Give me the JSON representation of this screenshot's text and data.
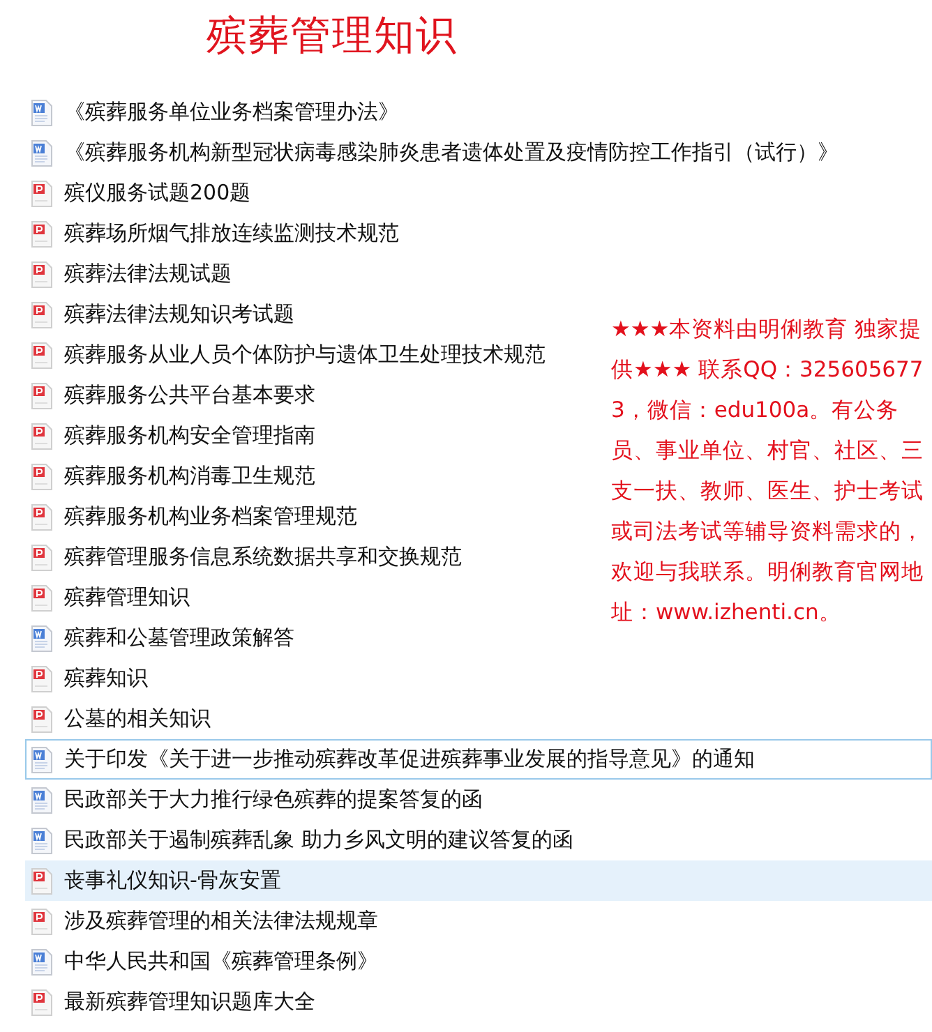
{
  "title": "殡葬管理知识",
  "files": [
    {
      "name": "《殡葬服务单位业务档案管理办法》",
      "kind": "word",
      "selected": false,
      "focused": false
    },
    {
      "name": "《殡葬服务机构新型冠状病毒感染肺炎患者遗体处置及疫情防控工作指引（试行）》",
      "kind": "word",
      "selected": false,
      "focused": false
    },
    {
      "name": "殡仪服务试题200题",
      "kind": "pdf",
      "selected": false,
      "focused": false
    },
    {
      "name": "殡葬场所烟气排放连续监测技术规范",
      "kind": "pdf",
      "selected": false,
      "focused": false
    },
    {
      "name": "殡葬法律法规试题",
      "kind": "pdf",
      "selected": false,
      "focused": false
    },
    {
      "name": "殡葬法律法规知识考试题",
      "kind": "pdf",
      "selected": false,
      "focused": false
    },
    {
      "name": "殡葬服务从业人员个体防护与遗体卫生处理技术规范",
      "kind": "pdf",
      "selected": false,
      "focused": false
    },
    {
      "name": "殡葬服务公共平台基本要求",
      "kind": "pdf",
      "selected": false,
      "focused": false
    },
    {
      "name": "殡葬服务机构安全管理指南",
      "kind": "pdf",
      "selected": false,
      "focused": false
    },
    {
      "name": "殡葬服务机构消毒卫生规范",
      "kind": "pdf",
      "selected": false,
      "focused": false
    },
    {
      "name": "殡葬服务机构业务档案管理规范",
      "kind": "pdf",
      "selected": false,
      "focused": false
    },
    {
      "name": "殡葬管理服务信息系统数据共享和交换规范",
      "kind": "pdf",
      "selected": false,
      "focused": false
    },
    {
      "name": "殡葬管理知识",
      "kind": "pdf",
      "selected": false,
      "focused": false
    },
    {
      "name": "殡葬和公墓管理政策解答",
      "kind": "word",
      "selected": false,
      "focused": false
    },
    {
      "name": "殡葬知识",
      "kind": "pdf",
      "selected": false,
      "focused": false
    },
    {
      "name": "公墓的相关知识",
      "kind": "pdf",
      "selected": false,
      "focused": false
    },
    {
      "name": "关于印发《关于进一步推动殡葬改革促进殡葬事业发展的指导意见》的通知",
      "kind": "word",
      "selected": false,
      "focused": true
    },
    {
      "name": "民政部关于大力推行绿色殡葬的提案答复的函",
      "kind": "word",
      "selected": false,
      "focused": false
    },
    {
      "name": "民政部关于遏制殡葬乱象 助力乡风文明的建议答复的函",
      "kind": "word",
      "selected": false,
      "focused": false
    },
    {
      "name": "丧事礼仪知识-骨灰安置",
      "kind": "pdf",
      "selected": true,
      "focused": false
    },
    {
      "name": "涉及殡葬管理的相关法律法规规章",
      "kind": "pdf",
      "selected": false,
      "focused": false
    },
    {
      "name": "中华人民共和国《殡葬管理条例》",
      "kind": "word",
      "selected": false,
      "focused": false
    },
    {
      "name": "最新殡葬管理知识题库大全",
      "kind": "pdf",
      "selected": false,
      "focused": false
    }
  ],
  "notice": "★★★本资料由明俐教育 独家提供★★★ 联系QQ：3256056773，微信：edu100a。有公务员、事业单位、村官、社区、三支一扶、教师、医生、护士考试或司法考试等辅导资料需求的，欢迎与我联系。明俐教育官网地址：www.izhenti.cn。"
}
